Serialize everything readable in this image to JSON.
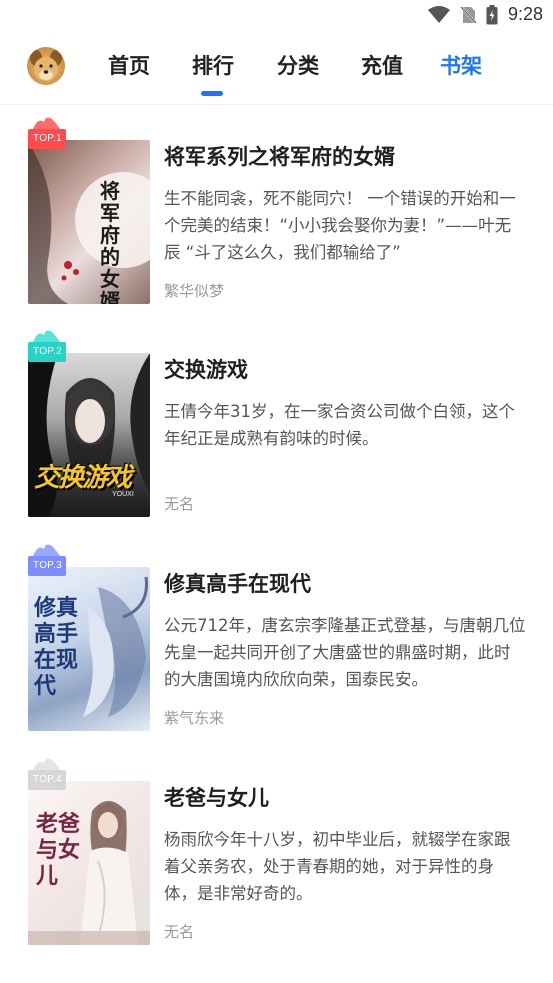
{
  "status_bar": {
    "time": "9:28"
  },
  "nav": {
    "tabs": [
      {
        "label": "首页"
      },
      {
        "label": "排行"
      },
      {
        "label": "分类"
      },
      {
        "label": "充值"
      },
      {
        "label": "书架"
      }
    ]
  },
  "books": [
    {
      "rank": "TOP.1",
      "title": "将军系列之将军府的女婿",
      "description": "生不能同衾，死不能同穴！ 一个错误的开始和一个完美的结束！“小小我会娶你为妻！”——叶无辰 “斗了这么久，我们都输给了”",
      "author": "繁华似梦",
      "badge_color": "#ff4b4b",
      "cover_text": "将军府的女婿"
    },
    {
      "rank": "TOP.2",
      "title": "交换游戏",
      "description": "王倩今年31岁，在一家合资公司做个白领，这个年纪正是成熟有韵味的时候。",
      "author": "无名",
      "badge_color": "#26d3c5",
      "cover_text": "交换游戏",
      "cover_subtext": "YOUXI"
    },
    {
      "rank": "TOP.3",
      "title": "修真高手在现代",
      "description": "公元712年，唐玄宗李隆基正式登基，与唐朝几位先皇一起共同开创了大唐盛世的鼎盛时期，此时的大唐国境内欣欣向荣，国泰民安。",
      "author": "紫气东来",
      "badge_color": "#7c8dff",
      "cover_text": "修真高手在现代"
    },
    {
      "rank": "TOP.4",
      "title": "老爸与女儿",
      "description": "杨雨欣今年十八岁，初中毕业后，就辍学在家跟着父亲务农，处于青春期的她，对于异性的身体，是非常好奇的。",
      "author": "无名",
      "badge_color": "#d6d6d6",
      "cover_text": "老爸与女儿"
    }
  ]
}
